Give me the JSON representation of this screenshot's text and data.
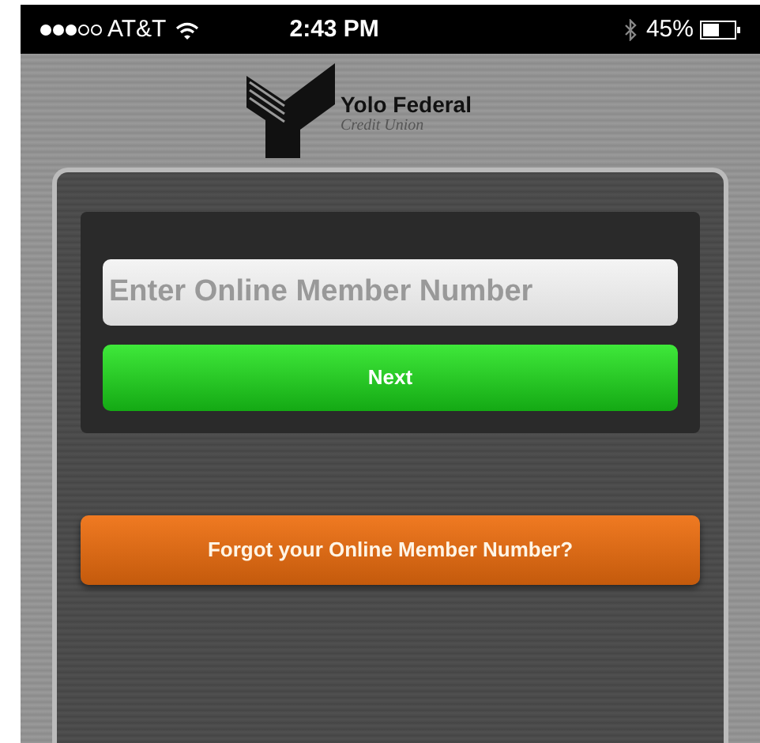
{
  "status_bar": {
    "carrier": "AT&T",
    "time": "2:43 PM",
    "battery": "45%"
  },
  "logo": {
    "name": "Yolo Federal",
    "subtitle": "Credit Union"
  },
  "login": {
    "member_number": {
      "placeholder": "Enter Online Member Number"
    },
    "next_button": "Next",
    "forgot_button": "Forgot your Online Member Number?"
  }
}
